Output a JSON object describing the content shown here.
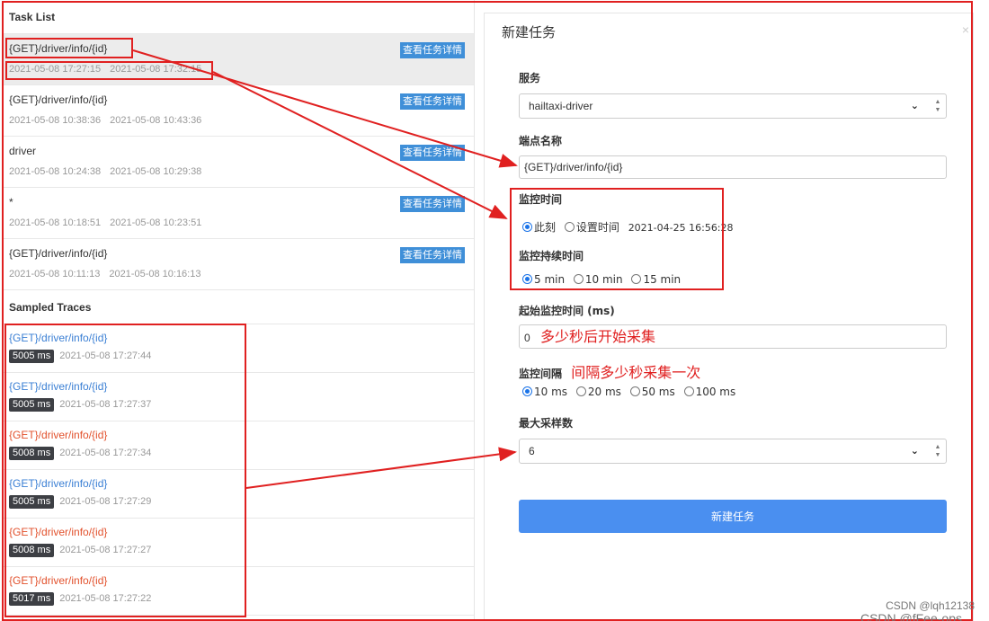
{
  "task_list": {
    "title": "Task List",
    "detail_button_label": "查看任务详情",
    "tasks": [
      {
        "endpoint": "{GET}/driver/info/{id}",
        "start": "2021-05-08 17:27:15",
        "end": "2021-05-08 17:32:15"
      },
      {
        "endpoint": "{GET}/driver/info/{id}",
        "start": "2021-05-08 10:38:36",
        "end": "2021-05-08 10:43:36"
      },
      {
        "endpoint": "driver",
        "start": "2021-05-08 10:24:38",
        "end": "2021-05-08 10:29:38"
      },
      {
        "endpoint": "*",
        "start": "2021-05-08 10:18:51",
        "end": "2021-05-08 10:23:51"
      },
      {
        "endpoint": "{GET}/driver/info/{id}",
        "start": "2021-05-08 10:11:13",
        "end": "2021-05-08 10:16:13"
      }
    ]
  },
  "sampled_traces": {
    "title": "Sampled Traces",
    "traces": [
      {
        "endpoint": "{GET}/driver/info/{id}",
        "duration": "5005 ms",
        "time": "2021-05-08 17:27:44",
        "color": "#3a7fd4"
      },
      {
        "endpoint": "{GET}/driver/info/{id}",
        "duration": "5005 ms",
        "time": "2021-05-08 17:27:37",
        "color": "#3a7fd4"
      },
      {
        "endpoint": "{GET}/driver/info/{id}",
        "duration": "5008 ms",
        "time": "2021-05-08 17:27:34",
        "color": "#e2512c"
      },
      {
        "endpoint": "{GET}/driver/info/{id}",
        "duration": "5005 ms",
        "time": "2021-05-08 17:27:29",
        "color": "#3a7fd4"
      },
      {
        "endpoint": "{GET}/driver/info/{id}",
        "duration": "5008 ms",
        "time": "2021-05-08 17:27:27",
        "color": "#e2512c"
      },
      {
        "endpoint": "{GET}/driver/info/{id}",
        "duration": "5017 ms",
        "time": "2021-05-08 17:27:22",
        "color": "#e2512c"
      }
    ]
  },
  "modal": {
    "title": "新建任务",
    "close_icon": "close-icon",
    "service_label": "服务",
    "service_value": "hailtaxi-driver",
    "endpoint_label": "端点名称",
    "endpoint_value": "{GET}/driver/info/{id}",
    "monitor_time_label": "监控时间",
    "monitor_time_options": [
      "此刻",
      "设置时间"
    ],
    "monitor_time_selected": 0,
    "monitor_time_value": "2021-04-25 16:56:28",
    "duration_label": "监控持续时间",
    "duration_options": [
      "5 min",
      "10 min",
      "15 min"
    ],
    "duration_selected": 0,
    "start_label": "起始监控时间 (ms)",
    "start_value": "0",
    "start_hint": "多少秒后开始采集",
    "interval_label": "监控间隔",
    "interval_hint": "间隔多少秒采集一次",
    "interval_options": [
      "10 ms",
      "20 ms",
      "50 ms",
      "100 ms"
    ],
    "interval_selected": 0,
    "max_samples_label": "最大采样数",
    "max_samples_value": "6",
    "submit_label": "新建任务"
  },
  "watermarks": [
    "CSDN @lqh12138",
    "CSDN @fFee-ops"
  ],
  "annotation_color": "#e02020",
  "accent_color": "#4a8ff0"
}
